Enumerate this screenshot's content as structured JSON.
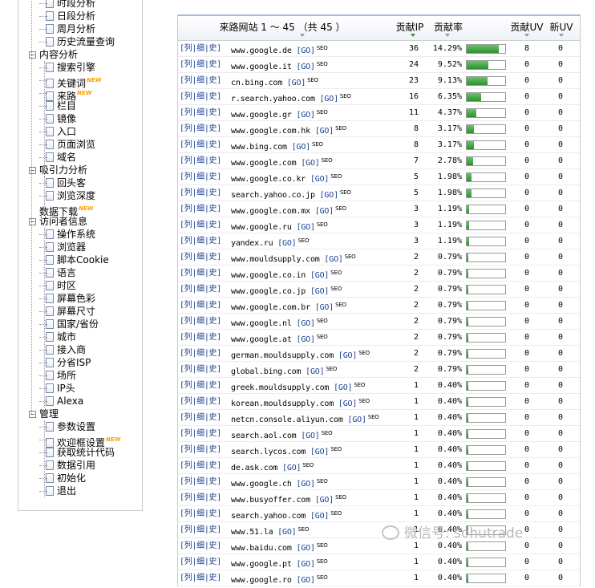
{
  "sidebar": {
    "items": [
      {
        "label": "时段分析",
        "level": 2,
        "icon": "doc-icon"
      },
      {
        "label": "日段分析",
        "level": 2,
        "icon": "doc-icon"
      },
      {
        "label": "周月分析",
        "level": 2,
        "icon": "doc-icon"
      },
      {
        "label": "历史流量查询",
        "level": 2,
        "icon": "doc-icon"
      },
      {
        "label": "内容分析",
        "level": 1,
        "icon": "minus-box-icon"
      },
      {
        "label": "搜索引擎",
        "level": 2,
        "icon": "doc-icon"
      },
      {
        "label": "关键词",
        "level": 2,
        "icon": "doc-icon",
        "tag": "NEW"
      },
      {
        "label": "来路",
        "level": 2,
        "icon": "doc-icon",
        "tag": "NEW"
      },
      {
        "label": "栏目",
        "level": 2,
        "icon": "doc-icon"
      },
      {
        "label": "镜像",
        "level": 2,
        "icon": "doc-icon"
      },
      {
        "label": "入口",
        "level": 2,
        "icon": "doc-icon"
      },
      {
        "label": "页面浏览",
        "level": 2,
        "icon": "doc-icon"
      },
      {
        "label": "域名",
        "level": 2,
        "icon": "doc-icon"
      },
      {
        "label": "吸引力分析",
        "level": 1,
        "icon": "minus-box-icon"
      },
      {
        "label": "回头客",
        "level": 2,
        "icon": "doc-icon"
      },
      {
        "label": "浏览深度",
        "level": 2,
        "icon": "doc-icon"
      },
      {
        "label": "数据下载",
        "level": 1,
        "icon": "none",
        "tag": "NEW"
      },
      {
        "label": "访问者信息",
        "level": 1,
        "icon": "minus-box-icon"
      },
      {
        "label": "操作系统",
        "level": 2,
        "icon": "doc-icon"
      },
      {
        "label": "浏览器",
        "level": 2,
        "icon": "doc-icon"
      },
      {
        "label": "脚本Cookie",
        "level": 2,
        "icon": "doc-icon"
      },
      {
        "label": "语言",
        "level": 2,
        "icon": "doc-icon"
      },
      {
        "label": "时区",
        "level": 2,
        "icon": "doc-icon"
      },
      {
        "label": "屏幕色彩",
        "level": 2,
        "icon": "doc-icon"
      },
      {
        "label": "屏幕尺寸",
        "level": 2,
        "icon": "doc-icon"
      },
      {
        "label": "国家/省份",
        "level": 2,
        "icon": "doc-icon"
      },
      {
        "label": "城市",
        "level": 2,
        "icon": "doc-icon"
      },
      {
        "label": "接入商",
        "level": 2,
        "icon": "doc-icon"
      },
      {
        "label": "分省ISP",
        "level": 2,
        "icon": "doc-icon"
      },
      {
        "label": "场所",
        "level": 2,
        "icon": "doc-icon"
      },
      {
        "label": "IP头",
        "level": 2,
        "icon": "doc-icon"
      },
      {
        "label": "Alexa",
        "level": 2,
        "icon": "doc-icon"
      },
      {
        "label": "管理",
        "level": 1,
        "icon": "minus-box-icon"
      },
      {
        "label": "参数设置",
        "level": 2,
        "icon": "doc-icon"
      },
      {
        "label": "欢迎框设置",
        "level": 2,
        "icon": "doc-icon",
        "tag": "NEW"
      },
      {
        "label": "获取统计代码",
        "level": 2,
        "icon": "doc-icon"
      },
      {
        "label": "数据引用",
        "level": 2,
        "icon": "doc-icon"
      },
      {
        "label": "初始化",
        "level": 2,
        "icon": "doc-icon"
      },
      {
        "label": "退出",
        "level": 2,
        "icon": "doc-icon"
      }
    ]
  },
  "table": {
    "headers": {
      "site": "来路网站 1 ～ 45 （共 45 ）",
      "ip": "贡献IP",
      "rate": "贡献率",
      "uv": "贡献UV",
      "new": "新UV"
    },
    "link_label": "[列|细|史]",
    "go_label": "[GO]",
    "seo_label": "SEO",
    "accent_color": "#2f8f2f",
    "rows": [
      {
        "site": "www.google.de",
        "ip": "36",
        "rate": "14.29%",
        "share": 14.29,
        "uv": "8",
        "new": "0"
      },
      {
        "site": "www.google.it",
        "ip": "24",
        "rate": "9.52%",
        "share": 9.52,
        "uv": "0",
        "new": "0"
      },
      {
        "site": "cn.bing.com",
        "ip": "23",
        "rate": "9.13%",
        "share": 9.13,
        "uv": "0",
        "new": "0"
      },
      {
        "site": "r.search.yahoo.com",
        "ip": "16",
        "rate": "6.35%",
        "share": 6.35,
        "uv": "0",
        "new": "0"
      },
      {
        "site": "www.google.gr",
        "ip": "11",
        "rate": "4.37%",
        "share": 4.37,
        "uv": "0",
        "new": "0"
      },
      {
        "site": "www.google.com.hk",
        "ip": "8",
        "rate": "3.17%",
        "share": 3.17,
        "uv": "0",
        "new": "0"
      },
      {
        "site": "www.bing.com",
        "ip": "8",
        "rate": "3.17%",
        "share": 3.17,
        "uv": "0",
        "new": "0"
      },
      {
        "site": "www.google.com",
        "ip": "7",
        "rate": "2.78%",
        "share": 2.78,
        "uv": "0",
        "new": "0"
      },
      {
        "site": "www.google.co.kr",
        "ip": "5",
        "rate": "1.98%",
        "share": 1.98,
        "uv": "0",
        "new": "0"
      },
      {
        "site": "search.yahoo.co.jp",
        "ip": "5",
        "rate": "1.98%",
        "share": 1.98,
        "uv": "0",
        "new": "0"
      },
      {
        "site": "www.google.com.mx",
        "ip": "3",
        "rate": "1.19%",
        "share": 1.19,
        "uv": "0",
        "new": "0"
      },
      {
        "site": "www.google.ru",
        "ip": "3",
        "rate": "1.19%",
        "share": 1.19,
        "uv": "0",
        "new": "0"
      },
      {
        "site": "yandex.ru",
        "ip": "3",
        "rate": "1.19%",
        "share": 1.19,
        "uv": "0",
        "new": "0"
      },
      {
        "site": "www.mouldsupply.com",
        "ip": "2",
        "rate": "0.79%",
        "share": 0.79,
        "uv": "0",
        "new": "0"
      },
      {
        "site": "www.google.co.in",
        "ip": "2",
        "rate": "0.79%",
        "share": 0.79,
        "uv": "0",
        "new": "0"
      },
      {
        "site": "www.google.co.jp",
        "ip": "2",
        "rate": "0.79%",
        "share": 0.79,
        "uv": "0",
        "new": "0"
      },
      {
        "site": "www.google.com.br",
        "ip": "2",
        "rate": "0.79%",
        "share": 0.79,
        "uv": "0",
        "new": "0"
      },
      {
        "site": "www.google.nl",
        "ip": "2",
        "rate": "0.79%",
        "share": 0.79,
        "uv": "0",
        "new": "0"
      },
      {
        "site": "www.google.at",
        "ip": "2",
        "rate": "0.79%",
        "share": 0.79,
        "uv": "0",
        "new": "0"
      },
      {
        "site": "german.mouldsupply.com",
        "ip": "2",
        "rate": "0.79%",
        "share": 0.79,
        "uv": "0",
        "new": "0"
      },
      {
        "site": "global.bing.com",
        "ip": "2",
        "rate": "0.79%",
        "share": 0.79,
        "uv": "0",
        "new": "0"
      },
      {
        "site": "greek.mouldsupply.com",
        "ip": "1",
        "rate": "0.40%",
        "share": 0.4,
        "uv": "0",
        "new": "0"
      },
      {
        "site": "korean.mouldsupply.com",
        "ip": "1",
        "rate": "0.40%",
        "share": 0.4,
        "uv": "0",
        "new": "0"
      },
      {
        "site": "netcn.console.aliyun.com",
        "ip": "1",
        "rate": "0.40%",
        "share": 0.4,
        "uv": "0",
        "new": "0"
      },
      {
        "site": "search.aol.com",
        "ip": "1",
        "rate": "0.40%",
        "share": 0.4,
        "uv": "0",
        "new": "0"
      },
      {
        "site": "search.lycos.com",
        "ip": "1",
        "rate": "0.40%",
        "share": 0.4,
        "uv": "0",
        "new": "0"
      },
      {
        "site": "de.ask.com",
        "ip": "1",
        "rate": "0.40%",
        "share": 0.4,
        "uv": "0",
        "new": "0"
      },
      {
        "site": "www.google.ch",
        "ip": "1",
        "rate": "0.40%",
        "share": 0.4,
        "uv": "0",
        "new": "0"
      },
      {
        "site": "www.busyoffer.com",
        "ip": "1",
        "rate": "0.40%",
        "share": 0.4,
        "uv": "0",
        "new": "0"
      },
      {
        "site": "search.yahoo.com",
        "ip": "1",
        "rate": "0.40%",
        "share": 0.4,
        "uv": "0",
        "new": "0"
      },
      {
        "site": "www.51.la",
        "ip": "1",
        "rate": "0.40%",
        "share": 0.4,
        "uv": "0",
        "new": "0"
      },
      {
        "site": "www.baidu.com",
        "ip": "1",
        "rate": "0.40%",
        "share": 0.4,
        "uv": "0",
        "new": "0"
      },
      {
        "site": "www.google.pt",
        "ip": "1",
        "rate": "0.40%",
        "share": 0.4,
        "uv": "0",
        "new": "0"
      },
      {
        "site": "www.google.ro",
        "ip": "1",
        "rate": "0.40%",
        "share": 0.4,
        "uv": "0",
        "new": "0"
      }
    ]
  },
  "watermark": {
    "text": "微信号: sohutrade",
    "icon": "wechat-icon"
  }
}
